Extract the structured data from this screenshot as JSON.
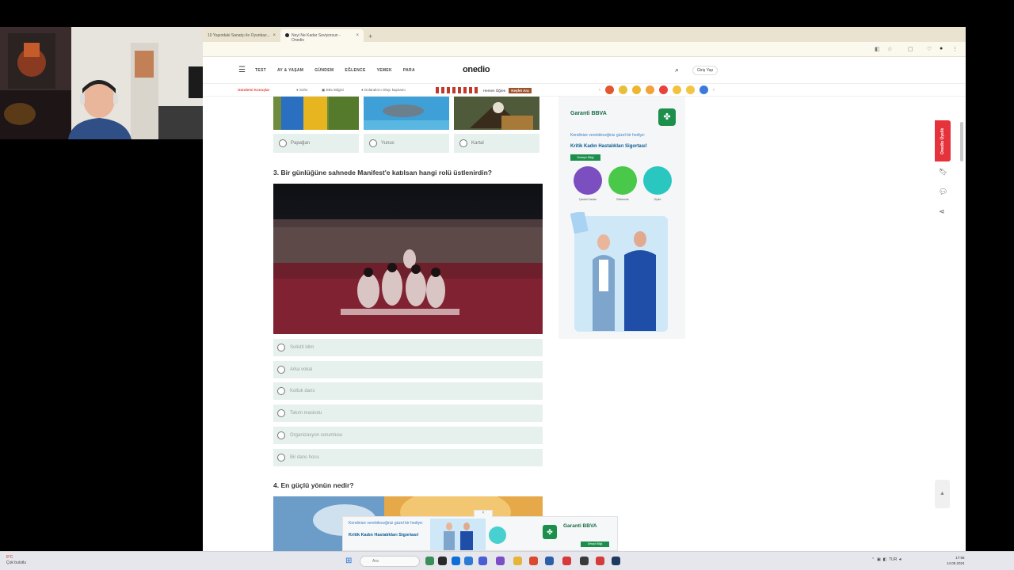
{
  "browser": {
    "tabs": [
      {
        "label": "10 Yaşındaki Sanatçı ile Oyunbaz...",
        "active": false
      },
      {
        "label": "Neyi Ne Kadar Seviyorsun - Onedio",
        "active": true
      }
    ],
    "new_tab_icon": "plus-icon"
  },
  "site": {
    "logo": "onedio",
    "nav": [
      "TEST",
      "AY & YAŞAM",
      "GÜNDEM",
      "EĞLENCE",
      "YEMEK",
      "PARA"
    ],
    "login_label": "Giriş Yap",
    "trend_label": "Gündemi Konuşlar",
    "trend_items": [
      "Sohn",
      "EBU Bilgisi",
      "Dolandırıcı Olayı kapsamı"
    ],
    "promo_text": "Hemen Öğren",
    "promo_badge": "Keşfet Ara",
    "emojis": [
      "#e2572f",
      "#e6c03a",
      "#f0b52e",
      "#f2a33a",
      "#e8423b",
      "#f3c23c",
      "#f4c444",
      "#3c7ad9"
    ]
  },
  "quiz": {
    "prev_question": {
      "options": [
        "Papağan",
        "Yunus",
        "Kartal"
      ]
    },
    "question3": {
      "title": "3. Bir günlüğüne sahnede Manifest'e katılsan hangi rolü üstlenirdin?",
      "options": [
        "Solistti ldim",
        "Arka vokal",
        "Koltuk dans",
        "Takım maskotu",
        "Organizasyon sorumlusu",
        "Bir dans hocu"
      ]
    },
    "question4": {
      "title": "4. En güçlü yönün nedir?"
    }
  },
  "side_ad": {
    "brand": "Garanti BBVA",
    "line1": "Kendinize verebileceğiniz güzel bir hediye:",
    "line2": "Kritik Kadın Hastalıkları Sigortası!",
    "button": "Detaylı Bilgi",
    "circles": [
      {
        "label": "Çanta/Cüzdan",
        "color": "#7b4fc0"
      },
      {
        "label": "Elektronik",
        "color": "#49c84a"
      },
      {
        "label": "Giyim",
        "color": "#2ac7c0"
      }
    ]
  },
  "bottom_ad": {
    "line1": "Kendinize verebileceğiniz güzel bir hediye:",
    "line2": "Kritik Kadın Hastalıkları Sigortası!",
    "brand": "Garanti BBVA",
    "button": "Detaylı Bilgi",
    "close": "×"
  },
  "right_rail": {
    "red_tab": "Onedio Üyelik",
    "icons": [
      "bookmark-icon",
      "comment-icon",
      "share-icon"
    ],
    "scroll_top": "▲"
  },
  "taskbar": {
    "weather": "8°C",
    "weather_sub": "Çok bulutlu",
    "search_placeholder": "Ara",
    "tray": "TUR",
    "time": "17:56",
    "date": "14.05.2024"
  }
}
